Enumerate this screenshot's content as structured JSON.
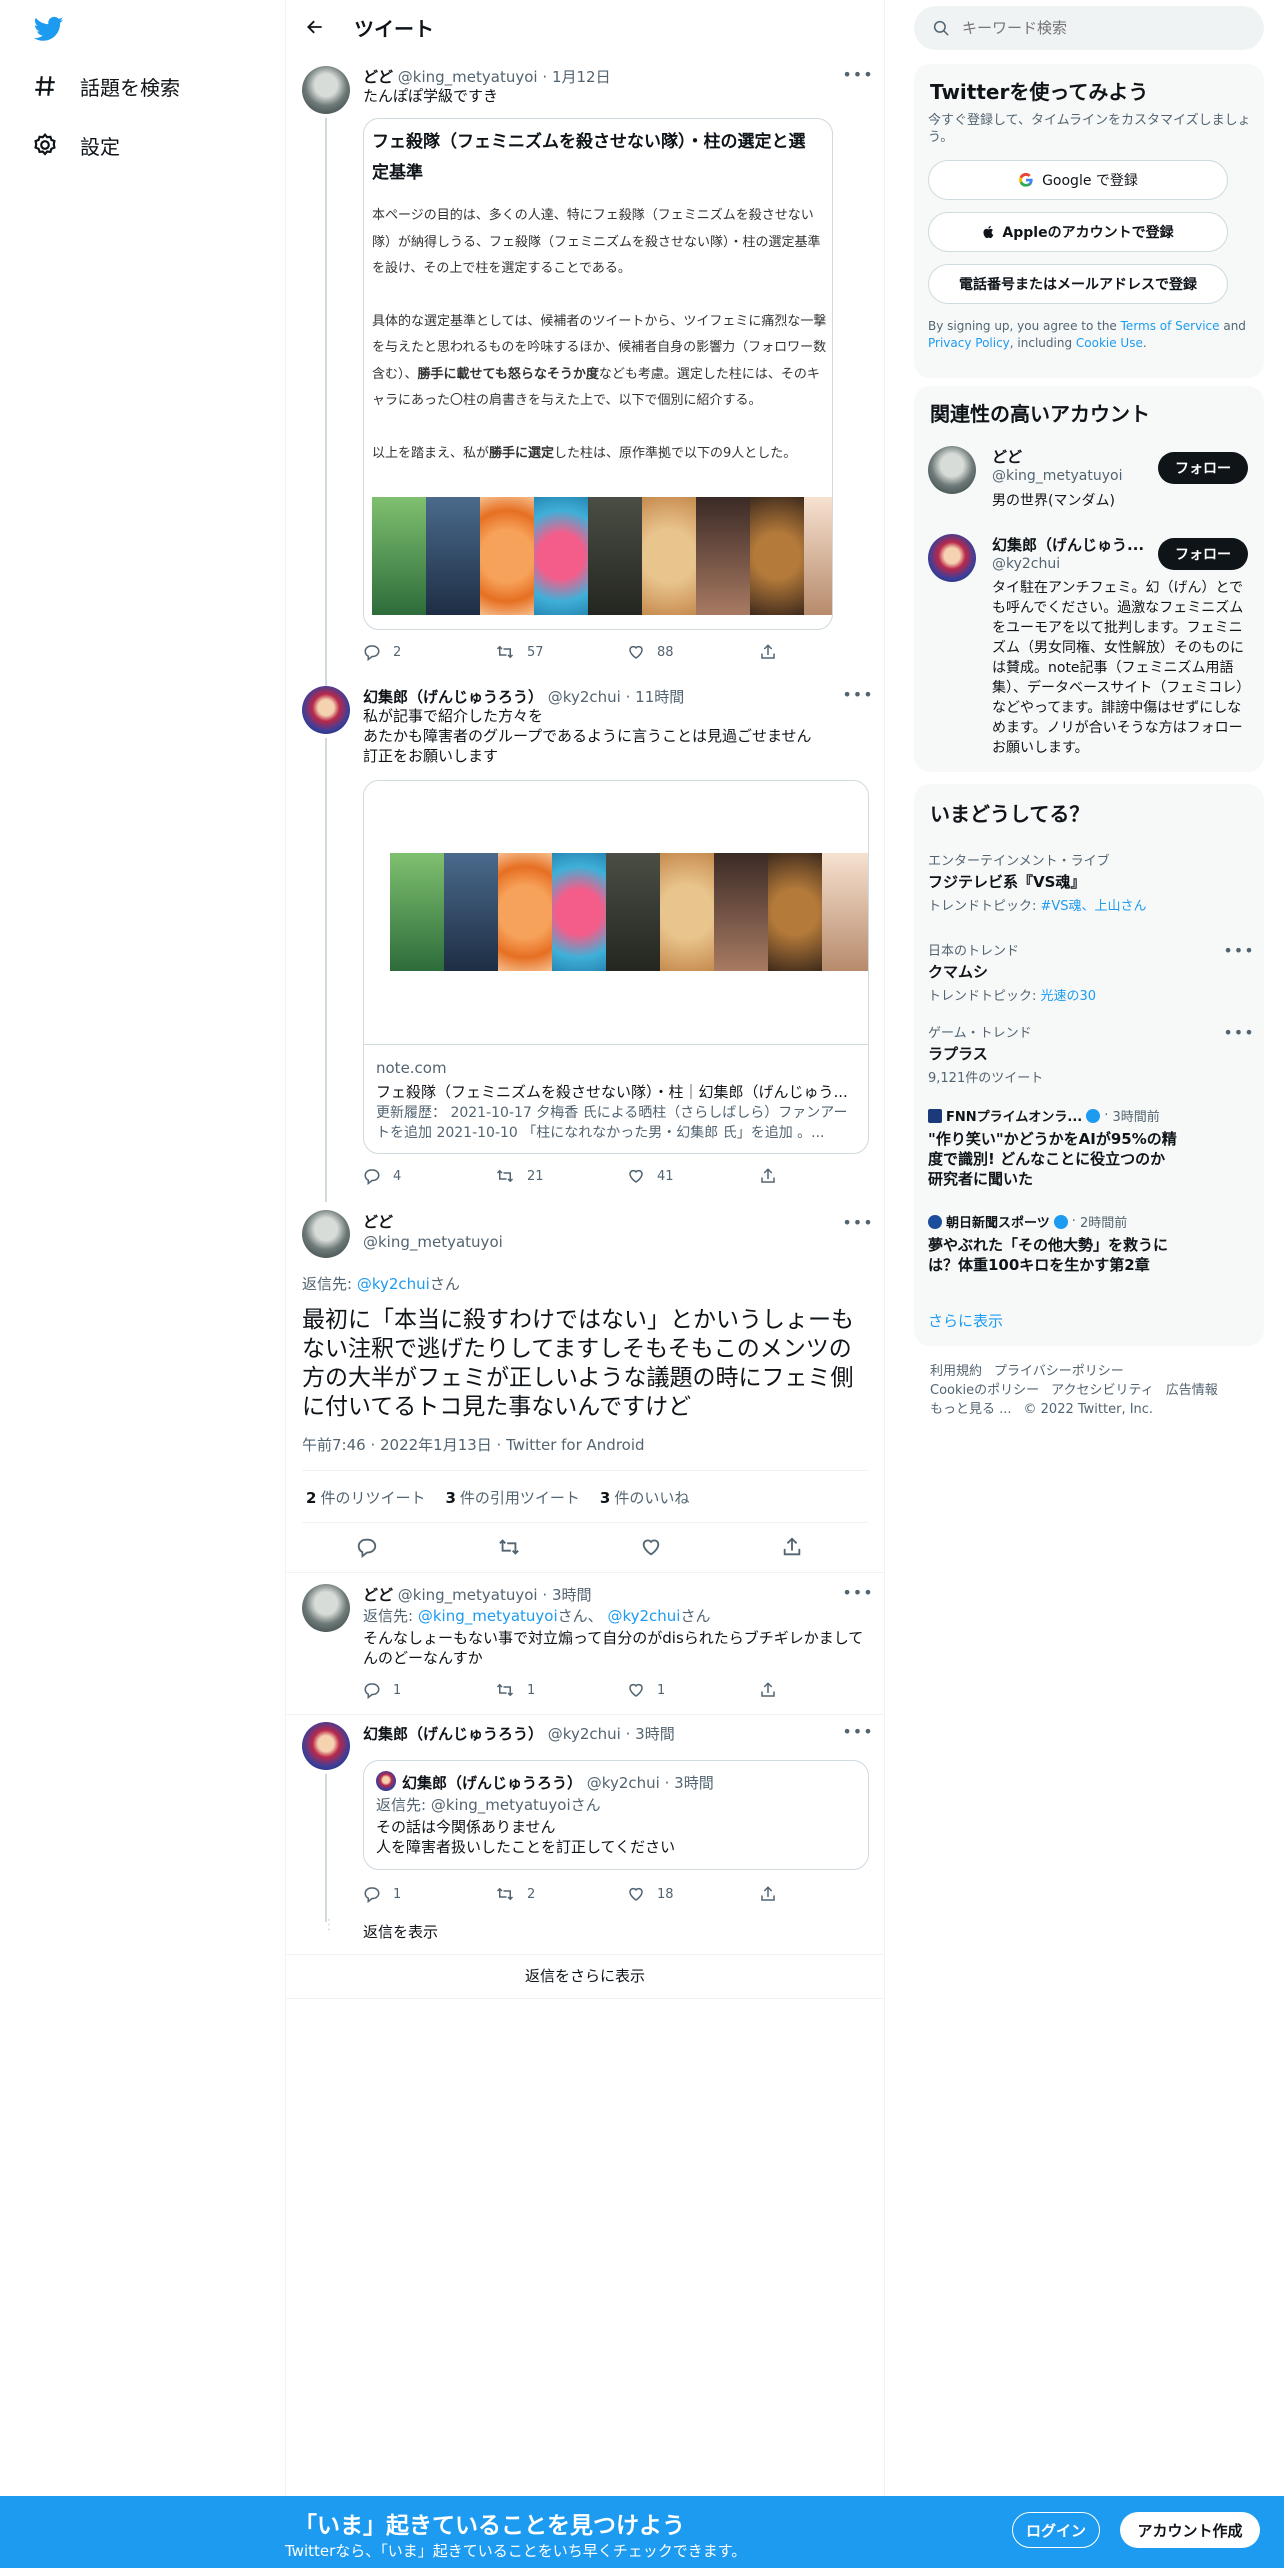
{
  "colors": {
    "accent": "#1d9bf0",
    "text": "#0f1419",
    "muted": "#536471",
    "border": "#eff3f4"
  },
  "nav": {
    "logo": "twitter-bird-icon",
    "explore": "話題を検索",
    "settings": "設定"
  },
  "header": {
    "title": "ツイート"
  },
  "tweet1": {
    "name": "どど",
    "handle": "@king_metyatuyoi",
    "sep": "·",
    "date": "1月12日",
    "text": "たんぽぽ学級ですき",
    "card": {
      "title": "フェ殺隊（フェミニズムを殺させない隊）・柱の選定と選定基準",
      "p1": "本ページの目的は、多くの人達、特にフェ殺隊（フェミニズムを殺させない隊）が納得しうる、フェ殺隊（フェミニズムを殺させない隊）・柱の選定基準を設け、その上で柱を選定することである。",
      "p2a": "具体的な選定基準としては、候補者のツイートから、ツイフェミに痛烈な一撃を与えたと思われるものを吟味するほか、候補者自身の影響力（フォロワー数含む）、",
      "p2b": "勝手に載せても怒らなそうか度",
      "p2c": "なども考慮。選定した柱には、そのキャラにあった〇柱の肩書きを与えた上で、以下で個別に紹介する。",
      "p3a": "以上を踏まえ、私が",
      "p3b": "勝手に選定",
      "p3c": "した柱は、原作準拠で以下の9人とした。"
    },
    "replies": "2",
    "retweets": "57",
    "likes": "88"
  },
  "tweet2": {
    "name": "幻集郎（げんじゅうろう）",
    "handle": "@ky2chui",
    "sep": "·",
    "time": "11時間",
    "line1": "私が記事で紹介した方々を",
    "line2": "あたかも障害者のグループであるように言うことは見過ごせません",
    "line3": "訂正をお願いします",
    "link": {
      "domain": "note.com",
      "title": "フェ殺隊（フェミニズムを殺させない隊）・柱｜幻集郎（げんじゅう...",
      "desc": "更新履歴： 2021-10-17 夕梅香 氏による晒柱（さらしばしら）ファンアートを追加 2021-10-10 「柱になれなかった男・幻集郎 氏」を追加 。..."
    },
    "replies": "4",
    "retweets": "21",
    "likes": "41"
  },
  "main_tweet": {
    "name": "どど",
    "handle": "@king_metyatuyoi",
    "reply_to_prefix": "返信先:",
    "reply_to": "@ky2chui",
    "reply_to_suffix": "さん",
    "text": "最初に「本当に殺すわけではない」とかいうしょーもない注釈で逃げたりしてますしそもそもこのメンツの方の大半がフェミが正しいような議題の時にフェミ側に付いてるトコ見た事ないんですけど",
    "timestamp": "午前7:46 · 2022年1月13日 · Twitter for Android",
    "rt_count": "2",
    "rt_label": "件のリツイート",
    "quote_count": "3",
    "quote_label": "件の引用ツイート",
    "like_count": "3",
    "like_label": "件のいいね"
  },
  "reply1": {
    "name": "どど",
    "handle": "@king_metyatuyoi",
    "sep": "·",
    "time": "3時間",
    "reply_prefix": "返信先:",
    "reply_a": "@king_metyatuyoi",
    "reply_mid": "さん、",
    "reply_b": "@ky2chui",
    "reply_suffix": "さん",
    "text": "そんなしょーもない事で対立煽って自分のがdisられたらブチギレかましてんのどーなんすか",
    "replies": "1",
    "retweets": "1",
    "likes": "1"
  },
  "reply2": {
    "name": "幻集郎（げんじゅうろう）",
    "handle": "@ky2chui",
    "sep": "·",
    "time": "3時間",
    "quote": {
      "name": "幻集郎（げんじゅうろう）",
      "handle": "@ky2chui",
      "sep": "·",
      "time": "3時間",
      "reply_prefix": "返信先:",
      "reply_to": "@king_metyatuyoi",
      "reply_suffix": "さん",
      "line1": "その話は今関係ありません",
      "line2": "人を障害者扱いしたことを訂正してください"
    },
    "replies": "1",
    "retweets": "2",
    "likes": "18",
    "show_replies": "返信を表示"
  },
  "show_more_replies": "返信をさらに表示",
  "sidebar": {
    "search_placeholder": "キーワード検索",
    "signup": {
      "title": "Twitterを使ってみよう",
      "sub": "今すぐ登録して、タイムラインをカスタマイズしましょう。",
      "google": "Google で登録",
      "apple": "Appleのアカウントで登録",
      "phone": "電話番号またはメールアドレスで登録",
      "terms_a": "By signing up, you agree to the ",
      "terms_link": "Terms of Service",
      "terms_b": " and ",
      "privacy_link": "Privacy Policy",
      "terms_c": ", including ",
      "cookie_link": "Cookie Use",
      "terms_d": "."
    },
    "related": {
      "title": "関連性の高いアカウント",
      "follow": "フォロー",
      "accounts": [
        {
          "name": "どど",
          "handle": "@king_metyatuyoi",
          "bio": "男の世界(マンダム)"
        },
        {
          "name": "幻集郎（げんじゅう...",
          "handle": "@ky2chui",
          "bio": "タイ駐在アンチフェミ。幻（げん）とでも呼んでください。過激なフェミニズムをユーモアを以て批判します。フェミニズム（男女同権、女性解放）そのものには賛成。note記事（フェミニズム用語集）、データベースサイト（フェミコレ）などやってます。誹謗中傷はせずにしなめます。ノリが合いそうな方はフォローお願いします。"
        }
      ]
    },
    "trends": {
      "title": "いまどうしてる？",
      "items": [
        {
          "meta": "エンターテインメント・ライブ",
          "title": "フジテレビ系『VS魂』",
          "sub_prefix": "トレンドトピック: ",
          "sub_links": "#VS魂、上山さん"
        },
        {
          "meta": "日本のトレンド",
          "title": "クマムシ",
          "sub_prefix": "トレンドトピック: ",
          "sub_links": "光速の30"
        },
        {
          "meta": "ゲーム・トレンド",
          "title": "ラプラス",
          "sub": "9,121件のツイート"
        }
      ],
      "news": [
        {
          "source": "FNNプライムオンラ...",
          "time": "3時間前",
          "headline": "\"作り笑い\"かどうかをAIが95%の精度で識別! どんなことに役立つのか研究者に聞いた"
        },
        {
          "source": "朝日新聞スポーツ",
          "time": "2時間前",
          "headline": "夢やぶれた「その他大勢」を救うには？体重100キロを生かす第2章"
        }
      ],
      "show_more": "さらに表示"
    },
    "footer": {
      "l1": [
        "利用規約",
        "プライバシーポリシー"
      ],
      "l2": [
        "Cookieのポリシー",
        "アクセシビリティ",
        "広告情報"
      ],
      "l3a": "もっと見る ...",
      "copyright": "© 2022 Twitter, Inc."
    }
  },
  "bottom": {
    "title": "「いま」起きていることを見つけよう",
    "sub": "Twitterなら、「いま」起きていることをいち早くチェックできます。",
    "login": "ログイン",
    "signup": "アカウント作成"
  }
}
